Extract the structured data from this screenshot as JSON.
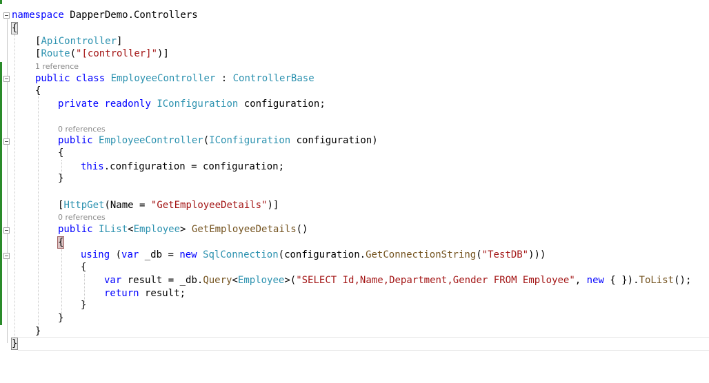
{
  "editor": {
    "lines": {
      "l1": [
        "namespace",
        " DapperDemo.Controllers"
      ],
      "l2": [
        "{"
      ],
      "l3": [
        "[",
        "ApiController",
        "]"
      ],
      "l4": [
        "[",
        "Route",
        "(",
        "\"[controller]\"",
        ")]"
      ],
      "lens1": "1 reference",
      "l5": [
        "public",
        " ",
        "class",
        " ",
        "EmployeeController",
        " : ",
        "ControllerBase"
      ],
      "l6": [
        "{"
      ],
      "l7": [
        "private",
        " ",
        "readonly",
        " ",
        "IConfiguration",
        " configuration;"
      ],
      "lens2": "0 references",
      "l8": [
        "public",
        " ",
        "EmployeeController",
        "(",
        "IConfiguration",
        " configuration)"
      ],
      "l9": [
        "{"
      ],
      "l10": [
        "this",
        ".configuration = configuration;"
      ],
      "l11": [
        "}"
      ],
      "l12": [
        "[",
        "HttpGet",
        "(Name = ",
        "\"GetEmployeeDetails\"",
        ")]"
      ],
      "lens3": "0 references",
      "l13": [
        "public",
        " ",
        "IList",
        "<",
        "Employee",
        "> ",
        "GetEmployeeDetails",
        "()"
      ],
      "l14": [
        "{"
      ],
      "l15": [
        "using",
        " (",
        "var",
        " _db = ",
        "new",
        " ",
        "SqlConnection",
        "(configuration.",
        "GetConnectionString",
        "(",
        "\"TestDB\"",
        ")))"
      ],
      "l16": [
        "{"
      ],
      "l17": [
        "var",
        " result = _db.",
        "Query",
        "<",
        "Employee",
        ">(",
        "\"SELECT Id,Name,Department,Gender FROM Employee\"",
        ", ",
        "new",
        " { }).",
        "ToList",
        "();"
      ],
      "l18": [
        "return",
        " result;"
      ],
      "l19": [
        "}"
      ],
      "l20": [
        "}"
      ],
      "l21": [
        "}"
      ],
      "l22": [
        "}"
      ]
    },
    "colors": {
      "keyword": "#0000ff",
      "type": "#2b91af",
      "string": "#a31515",
      "method": "#74531f",
      "lens": "#8a8a8a",
      "change_bar": "#2a8b2a"
    },
    "icons": [
      "collapse-icon"
    ]
  }
}
